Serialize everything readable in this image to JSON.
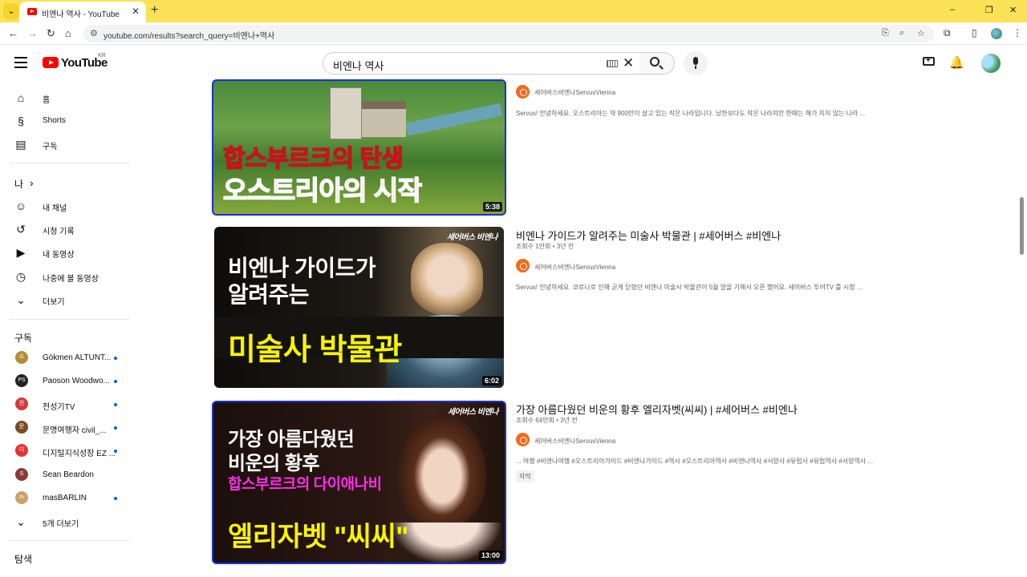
{
  "browser": {
    "tab_title": "비엔나 역사 - YouTube",
    "url": "youtube.com/results?search_query=비엔나+역사",
    "menu_glyph": "⌄",
    "close_glyph": "✕",
    "newtab_glyph": "+",
    "back_glyph": "←",
    "forward_glyph": "→",
    "reload_glyph": "↻",
    "home_glyph": "⌂",
    "tune_glyph": "⚙",
    "cast_glyph": "⎘",
    "zoom_glyph": "⌕",
    "star_glyph": "☆",
    "ext_glyph": "⧉",
    "side_glyph": "▯",
    "more_glyph": "⋮",
    "minimize_glyph": "–",
    "restore_glyph": "❐",
    "winclose_glyph": "✕"
  },
  "header": {
    "logo_text": "YouTube",
    "logo_region": "KR",
    "search_query": "비엔나 역사",
    "clear_glyph": "✕",
    "bell_glyph": "🔔"
  },
  "sidebar": {
    "main": [
      {
        "label": "홈",
        "icon": "⌂"
      },
      {
        "label": "Shorts",
        "icon": "§"
      },
      {
        "label": "구독",
        "icon": "▤"
      }
    ],
    "you_heading": "나",
    "you_chevron": "›",
    "you": [
      {
        "label": "내 채널",
        "icon": "☺"
      },
      {
        "label": "시청 기록",
        "icon": "↺"
      },
      {
        "label": "내 동영상",
        "icon": "▶"
      },
      {
        "label": "나중에 볼 동영상",
        "icon": "◷"
      },
      {
        "label": "더보기",
        "icon": "⌄"
      }
    ],
    "subs_heading": "구독",
    "subs": [
      {
        "label": "Gökmen ALTUNT...",
        "av": "G",
        "color": "#b58b3a",
        "dot": true
      },
      {
        "label": "Paoson Woodwo...",
        "av": "PS",
        "color": "#222222",
        "dot": true
      },
      {
        "label": "전성기TV",
        "av": "전",
        "color": "#d13b3b",
        "dot": true
      },
      {
        "label": "문명여행자 civil_...",
        "av": "문",
        "color": "#7a4a20",
        "dot": true
      },
      {
        "label": "디지털지식성장 EZ ...",
        "av": "디",
        "color": "#e23636",
        "dot": true
      },
      {
        "label": "Sean Beardon",
        "av": "S",
        "color": "#8b3a3a",
        "dot": false
      },
      {
        "label": "masBARLIN",
        "av": "m",
        "color": "#c9a26b",
        "dot": true
      }
    ],
    "more_subs": "5개 더보기",
    "more_subs_icon": "⌄",
    "explore_heading": "탐색"
  },
  "results": [
    {
      "title": "",
      "meta": "",
      "channel": "세어버스비엔나ServusVienna",
      "desc": "Servus! 안녕하세요. 오스트리아는 약 900만이 살고 있는 작은 나라입니다. 남한보다도 작은 나라지만 한때는 해가 지지 않는 나라 ...",
      "duration": "5:38",
      "thumb_lines": [
        "합스부르크의 탄생",
        "오스트리아의 시작"
      ]
    },
    {
      "title": "비엔나 가이드가 알려주는 미술사 박물관 | #세어버스 #비엔나",
      "meta": "조회수 1만회 • 3년 전",
      "channel": "세어버스비엔나ServusVienna",
      "desc": "Servus! 안녕하세요. 코로나로 인해 굳게 닫혔던 비엔나 미술사 박물관이 5월 말을 기해서 오픈 했어요. 세어버스 투어TV 를 시청 ...",
      "duration": "6:02",
      "thumb_lines": [
        "비엔나 가이드가",
        "알려주는",
        "미술사 박물관"
      ],
      "thumb_brand": "세어버스 비엔나"
    },
    {
      "title": "가장 아름다웠던 비운의 황후 엘리자벳(씨씨) | #세어버스 #비엔나",
      "meta": "조회수 64만회 • 3년 전",
      "channel": "세어버스비엔나ServusVienna",
      "desc": "... 여행 #비엔나여행 #오스트리아가이드 #비엔나가이드 #역사 #오스트리아역사 #비엔나역사 #서양사 #유럽사 #유럽역사 #서양역사 ...",
      "badge": "자막",
      "duration": "13:00",
      "thumb_lines": [
        "가장 아름다웠던",
        "비운의 황후",
        "합스부르크의 다이애나비",
        "엘리자벳 \"씨씨\""
      ],
      "thumb_brand": "세어버스 비엔나"
    }
  ]
}
